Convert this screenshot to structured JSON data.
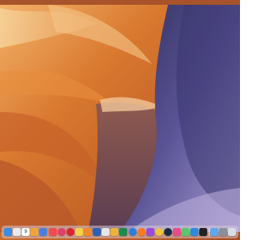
{
  "desktop": {
    "wallpaper_colors": {
      "orange_dark": "#b5521f",
      "orange": "#d9782f",
      "orange_light": "#f3b46a",
      "cream": "#f8d9a3",
      "purple_dark": "#3d3a6b",
      "purple": "#6a62a6",
      "lavender": "#9d8fc3",
      "brown": "#7a4a4a"
    },
    "menubar_color": "#a8532a"
  },
  "dock": {
    "items": [
      {
        "icon": "finder-icon",
        "color": "#3b8de6"
      },
      {
        "icon": "launchpad-icon",
        "color": "#e9e9ee"
      },
      {
        "icon": "calendar-icon",
        "color": "#ffffff",
        "text": "9"
      },
      {
        "icon": "photos-icon",
        "color": "#f2a33a"
      },
      {
        "icon": "mail-icon",
        "color": "#4a7fe0"
      },
      {
        "icon": "news-icon",
        "color": "#f24b4b"
      },
      {
        "icon": "swirl-app-icon",
        "color": "#e0406a"
      },
      {
        "icon": "opera-icon",
        "color": "#d8262f"
      },
      {
        "icon": "notes-icon",
        "color": "#f5d04a"
      },
      {
        "icon": "books-icon",
        "color": "#f08a2a"
      },
      {
        "icon": "word-icon",
        "color": "#2b5fb8"
      },
      {
        "icon": "preview-icon",
        "color": "#e6e6e6"
      },
      {
        "icon": "pencil-icon",
        "color": "#f0b33a"
      },
      {
        "icon": "excel-icon",
        "color": "#1f8a4a"
      },
      {
        "icon": "browser-icon",
        "color": "#2d7de0"
      },
      {
        "icon": "firefox-icon",
        "color": "#ff7a1a"
      },
      {
        "icon": "purple-app-icon",
        "color": "#9c4ad8"
      },
      {
        "icon": "chrome-icon",
        "color": "#f2c53a"
      },
      {
        "icon": "steam-icon",
        "color": "#1b2a44"
      },
      {
        "icon": "pink-app-icon",
        "color": "#e84a8a"
      },
      {
        "icon": "maps-icon",
        "color": "#5cc86a"
      },
      {
        "icon": "vscode-icon",
        "color": "#2a8ae0"
      },
      {
        "icon": "terminal-icon",
        "color": "#222222"
      },
      {
        "icon": "folder-icon",
        "color": "#5aa9f0"
      },
      {
        "icon": "settings-icon",
        "color": "#8a8f99"
      },
      {
        "icon": "trash-icon",
        "color": "#d8dde5"
      }
    ]
  }
}
